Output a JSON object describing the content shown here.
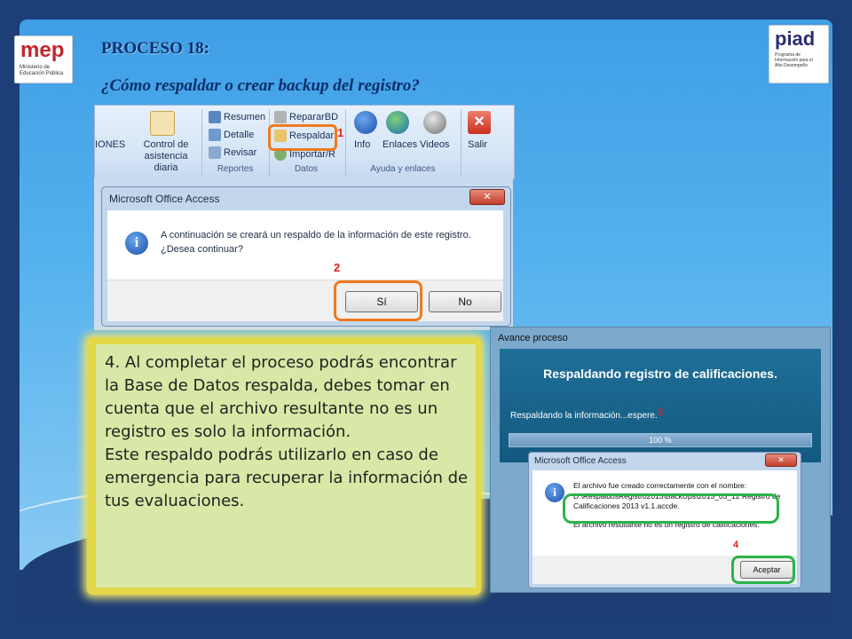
{
  "header": {
    "title": "PROCESO 18:",
    "subtitle": "¿Cómo  respaldar o crear backup del registro?"
  },
  "logos": {
    "left": {
      "word": "mep",
      "sub": "Ministerio de Educación Pública"
    },
    "right": {
      "word": "piad",
      "sub": "Programa de Información para el Alto Desempeño"
    }
  },
  "ribbon": {
    "partial_label": "IONES",
    "control_label_1": "Control de",
    "control_label_2": "asistencia diaria",
    "reportes": {
      "items": [
        "Resumen",
        "Detalle",
        "Revisar"
      ],
      "group": "Reportes"
    },
    "datos": {
      "items": [
        "RepararBD",
        "Respaldar",
        "Importar/R"
      ],
      "group": "Datos"
    },
    "ayuda": {
      "items": [
        "Info",
        "Enlaces",
        "Videos"
      ],
      "group": "Ayuda y enlaces"
    },
    "salir": "Salir"
  },
  "step_numbers": {
    "n1": "1",
    "n2": "2",
    "n3": "3",
    "n4": "4"
  },
  "dialog1": {
    "title": "Microsoft Office Access",
    "line1": "A continuación se creará un respaldo de la información de este registro.",
    "line2": "¿Desea continuar?",
    "yes": "Sí",
    "no": "No"
  },
  "note": {
    "paragraph1": "4. Al completar el proceso podrás encontrar la Base de Datos respalda, debes tomar en cuenta que el archivo resultante no es un registro es solo la información.",
    "paragraph2": "Este respaldo podrás utilizarlo en caso de emergencia para recuperar la información de tus evaluaciones."
  },
  "progress_window": {
    "title": "Avance proceso",
    "heading": "Respaldando registro de calificaciones.",
    "message": "Respaldando la información...espere.",
    "percent_label": "100 %",
    "progress": 1.0
  },
  "dialog2": {
    "title": "Microsoft Office Access",
    "line1": "El archivo fue creado correctamente con el nombre:",
    "path1": "D:\\RespaldosRegistro2013\\BackUps\\2013_03_12 Registro de",
    "path2": "Calificaciones 2013 v1.1.accde.",
    "line3": "El archivo resultante no es un registro de calificaciones.",
    "ok": "Aceptar"
  },
  "colors": {
    "highlight_orange": "#f07a1e",
    "highlight_green": "#2bb34a",
    "step_red": "#e02020",
    "note_bg": "#d9e8a6"
  }
}
